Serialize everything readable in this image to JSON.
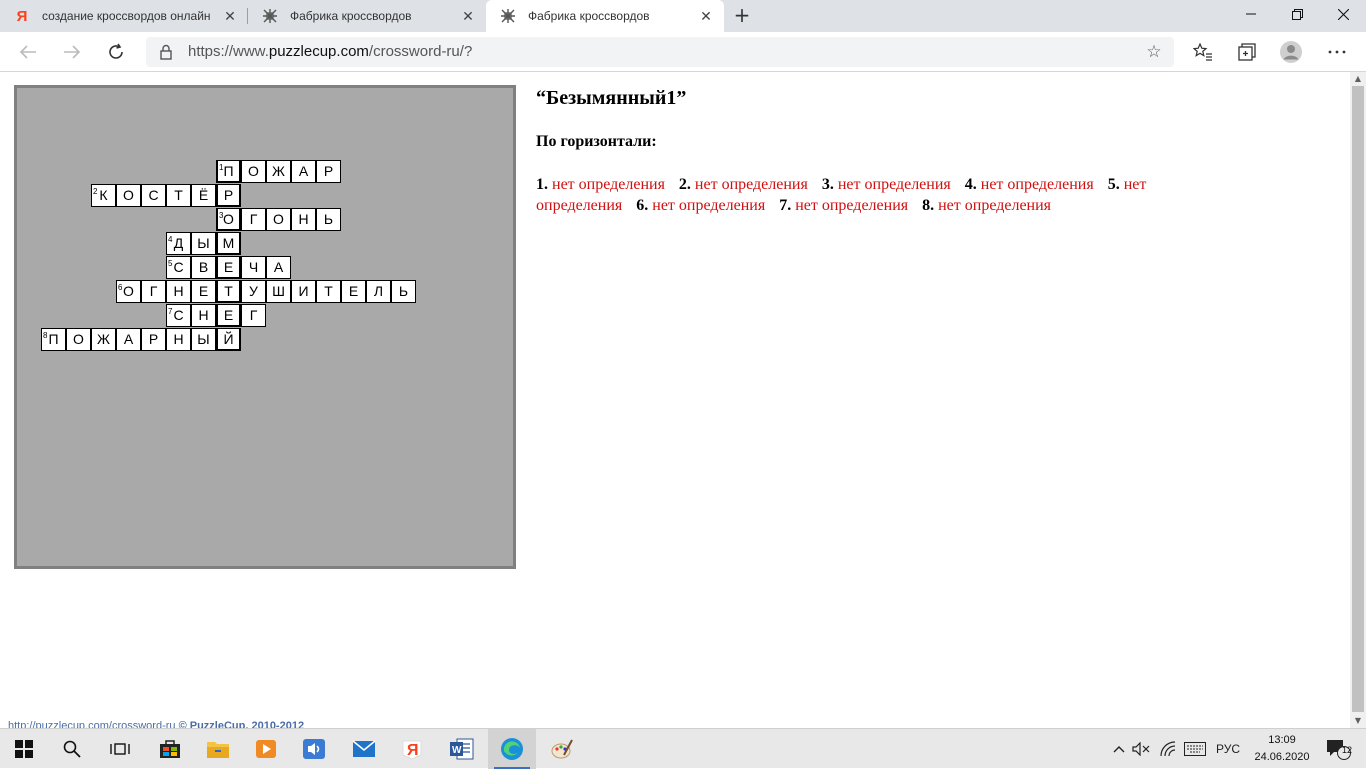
{
  "browser": {
    "tabs": [
      {
        "title": "создание кроссвордов онлайн",
        "icon": "yandex-icon",
        "active": false
      },
      {
        "title": "Фабрика кроссвордов",
        "icon": "crossword-favicon",
        "active": false
      },
      {
        "title": "Фабрика кроссвордов",
        "icon": "crossword-favicon",
        "active": true
      }
    ],
    "url_prefix": "https://www.",
    "url_host": "puzzlecup.com",
    "url_path": "/crossword-ru/?"
  },
  "crossword": {
    "words": [
      {
        "num": "1",
        "row": 0,
        "col": 7,
        "letters": [
          "П",
          "О",
          "Ж",
          "А",
          "Р"
        ]
      },
      {
        "num": "2",
        "row": 1,
        "col": 2,
        "letters": [
          "К",
          "О",
          "С",
          "Т",
          "Ё",
          "Р"
        ]
      },
      {
        "num": "3",
        "row": 2,
        "col": 7,
        "letters": [
          "О",
          "Г",
          "О",
          "Н",
          "Ь"
        ]
      },
      {
        "num": "4",
        "row": 3,
        "col": 5,
        "letters": [
          "Д",
          "Ы",
          "М"
        ]
      },
      {
        "num": "5",
        "row": 4,
        "col": 5,
        "letters": [
          "С",
          "В",
          "Е",
          "Ч",
          "А"
        ]
      },
      {
        "num": "6",
        "row": 5,
        "col": 3,
        "letters": [
          "О",
          "Г",
          "Н",
          "Е",
          "Т",
          "У",
          "Ш",
          "И",
          "Т",
          "Е",
          "Л",
          "Ь"
        ]
      },
      {
        "num": "7",
        "row": 6,
        "col": 5,
        "letters": [
          "С",
          "Н",
          "Е",
          "Г"
        ]
      },
      {
        "num": "8",
        "row": 7,
        "col": 0,
        "letters": [
          "П",
          "О",
          "Ж",
          "А",
          "Р",
          "Н",
          "Ы",
          "Й"
        ]
      }
    ],
    "key_column": 7
  },
  "panel": {
    "title": "“Безымянный1”",
    "across_heading": "По горизонтали:",
    "clues": [
      {
        "num": "1.",
        "text": "нет определения"
      },
      {
        "num": "2.",
        "text": "нет определения"
      },
      {
        "num": "3.",
        "text": "нет определения"
      },
      {
        "num": "4.",
        "text": "нет определения"
      },
      {
        "num": "5.",
        "text": "нет определения"
      },
      {
        "num": "6.",
        "text": "нет определения"
      },
      {
        "num": "7.",
        "text": "нет определения"
      },
      {
        "num": "8.",
        "text": "нет определения"
      }
    ]
  },
  "footer": {
    "link": "http://puzzlecup.com/crossword-ru",
    "copyright": "© PuzzleCup, 2010-2012"
  },
  "taskbar": {
    "language": "РУС",
    "time": "13:09",
    "date": "24.06.2020",
    "notifications": "12"
  },
  "colors": {
    "clue_text": "#d01010",
    "board_bg": "#a9a9a9",
    "taskbar_accent": "#3a6fc4"
  }
}
